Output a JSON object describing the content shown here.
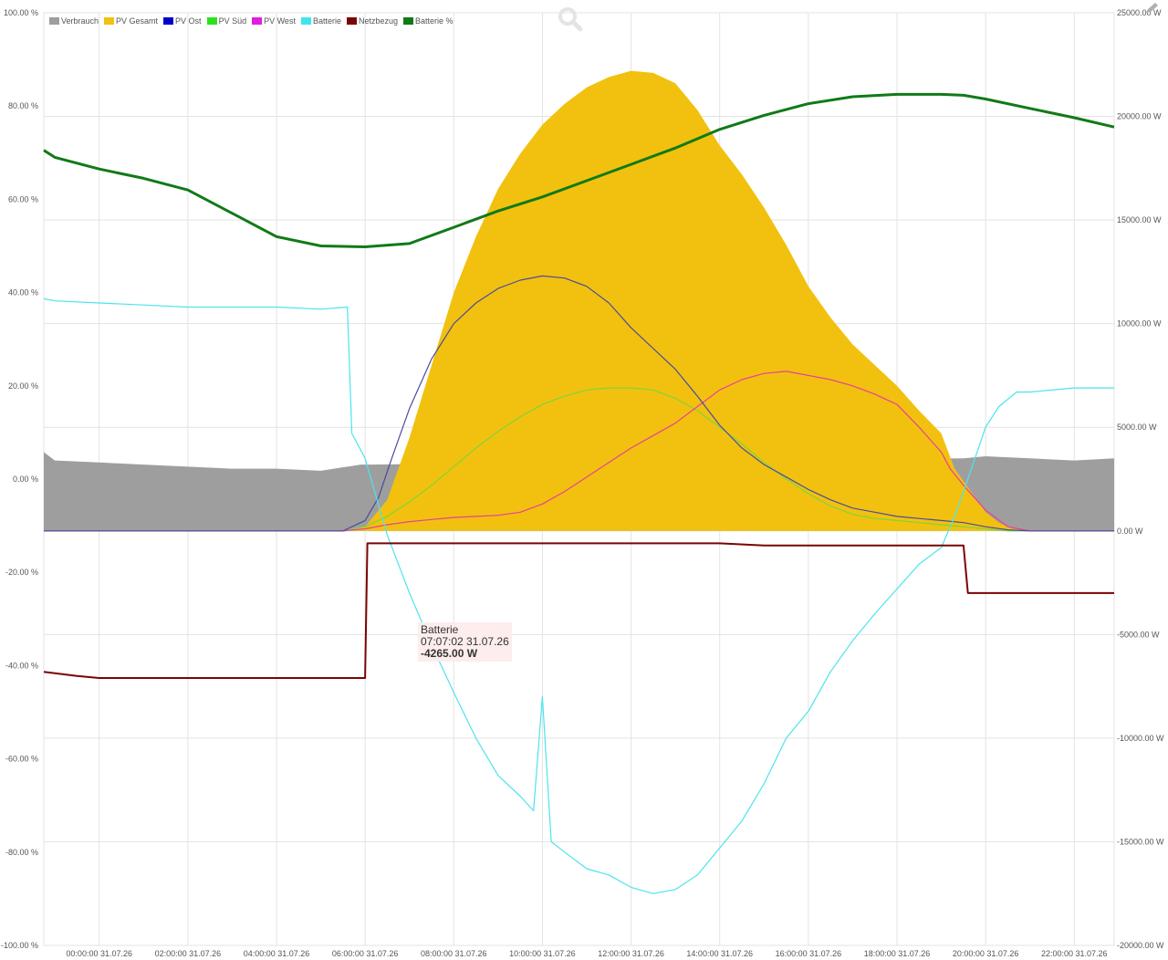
{
  "chart_data": {
    "type": "area",
    "y_left": {
      "min": -100,
      "max": 100,
      "ticks": [
        "100.00 %",
        "80.00 %",
        "60.00 %",
        "40.00 %",
        "20.00 %",
        "0.00 %",
        "-20.00 %",
        "-40.00 %",
        "-60.00 %",
        "-80.00 %",
        "-100.00 %"
      ]
    },
    "y_right": {
      "min": -20000,
      "max": 25000,
      "ticks": [
        "25000.00 W",
        "20000.00 W",
        "15000.00 W",
        "10000.00 W",
        "5000.00 W",
        "0.00 W",
        "-5000.00 W",
        "-10000.00 W",
        "-15000.00 W",
        "-20000.00 W"
      ]
    },
    "x_range_hours": [
      23.0,
      22.9
    ],
    "x_ticks": [
      {
        "h": 0,
        "label": "00:00:00 31.07.26"
      },
      {
        "h": 2,
        "label": "02:00:00 31.07.26"
      },
      {
        "h": 4,
        "label": "04:00:00 31.07.26"
      },
      {
        "h": 6,
        "label": "06:00:00 31.07.26"
      },
      {
        "h": 8,
        "label": "08:00:00 31.07.26"
      },
      {
        "h": 10,
        "label": "10:00:00 31.07.26"
      },
      {
        "h": 12,
        "label": "12:00:00 31.07.26"
      },
      {
        "h": 14,
        "label": "14:00:00 31.07.26"
      },
      {
        "h": 16,
        "label": "16:00:00 31.07.26"
      },
      {
        "h": 18,
        "label": "18:00:00 31.07.26"
      },
      {
        "h": 20,
        "label": "20:00:00 31.07.26"
      },
      {
        "h": 22,
        "label": "22:00:00 31.07.26"
      }
    ],
    "grid": true,
    "legend_position": "top-left",
    "series": [
      {
        "name": "Verbrauch",
        "color": "#9e9e9e",
        "axis": "W",
        "style": "area",
        "points": [
          [
            -1.25,
            3800
          ],
          [
            -1,
            3400
          ],
          [
            0,
            3300
          ],
          [
            1,
            3200
          ],
          [
            2,
            3100
          ],
          [
            3,
            3000
          ],
          [
            4,
            3000
          ],
          [
            5,
            2900
          ],
          [
            5.9,
            3200
          ],
          [
            6.1,
            3200
          ],
          [
            19.5,
            3500
          ],
          [
            20,
            3600
          ],
          [
            21,
            3500
          ],
          [
            22,
            3400
          ],
          [
            22.9,
            3500
          ]
        ]
      },
      {
        "name": "PV Gesamt",
        "color": "#f2c10f",
        "axis": "W",
        "style": "area",
        "points": [
          [
            -1.25,
            0
          ],
          [
            5.5,
            0
          ],
          [
            6,
            200
          ],
          [
            6.5,
            1500
          ],
          [
            7,
            4500
          ],
          [
            7.5,
            8000
          ],
          [
            8,
            11500
          ],
          [
            8.5,
            14200
          ],
          [
            9,
            16500
          ],
          [
            9.5,
            18200
          ],
          [
            10,
            19600
          ],
          [
            10.5,
            20600
          ],
          [
            11,
            21400
          ],
          [
            11.5,
            21900
          ],
          [
            12,
            22200
          ],
          [
            12.5,
            22100
          ],
          [
            13,
            21600
          ],
          [
            13.5,
            20300
          ],
          [
            14,
            18600
          ],
          [
            14.5,
            17200
          ],
          [
            15,
            15600
          ],
          [
            15.5,
            13800
          ],
          [
            16,
            11800
          ],
          [
            16.5,
            10300
          ],
          [
            17,
            9000
          ],
          [
            17.5,
            8000
          ],
          [
            18,
            7000
          ],
          [
            18.5,
            5800
          ],
          [
            19,
            4700
          ],
          [
            19.3,
            3000
          ],
          [
            19.7,
            1800
          ],
          [
            20,
            900
          ],
          [
            20.3,
            400
          ],
          [
            20.6,
            100
          ],
          [
            21,
            0
          ],
          [
            22.9,
            0
          ]
        ]
      },
      {
        "name": "PV Ost",
        "color": "#4b4b9e",
        "axis": "W",
        "style": "line",
        "points": [
          [
            -1.25,
            0
          ],
          [
            5.5,
            0
          ],
          [
            6,
            500
          ],
          [
            6.3,
            1600
          ],
          [
            6.6,
            3500
          ],
          [
            7,
            5900
          ],
          [
            7.5,
            8300
          ],
          [
            8,
            10000
          ],
          [
            8.5,
            11000
          ],
          [
            9,
            11700
          ],
          [
            9.5,
            12100
          ],
          [
            10,
            12300
          ],
          [
            10.5,
            12200
          ],
          [
            11,
            11800
          ],
          [
            11.5,
            11000
          ],
          [
            12,
            9800
          ],
          [
            12.5,
            8800
          ],
          [
            13,
            7800
          ],
          [
            13.5,
            6500
          ],
          [
            14,
            5100
          ],
          [
            14.5,
            4000
          ],
          [
            15,
            3200
          ],
          [
            15.5,
            2600
          ],
          [
            16,
            2000
          ],
          [
            16.5,
            1500
          ],
          [
            17,
            1100
          ],
          [
            17.5,
            900
          ],
          [
            18,
            700
          ],
          [
            18.5,
            600
          ],
          [
            19,
            500
          ],
          [
            19.5,
            400
          ],
          [
            20,
            200
          ],
          [
            20.5,
            50
          ],
          [
            21,
            0
          ],
          [
            22.9,
            0
          ]
        ]
      },
      {
        "name": "PV Süd",
        "color": "#7cd63a",
        "axis": "W",
        "style": "line",
        "points": [
          [
            -1.25,
            0
          ],
          [
            5.5,
            0
          ],
          [
            6,
            200
          ],
          [
            6.5,
            700
          ],
          [
            7,
            1400
          ],
          [
            7.5,
            2200
          ],
          [
            8,
            3100
          ],
          [
            8.5,
            4000
          ],
          [
            9,
            4800
          ],
          [
            9.5,
            5500
          ],
          [
            10,
            6100
          ],
          [
            10.5,
            6500
          ],
          [
            11,
            6800
          ],
          [
            11.5,
            6900
          ],
          [
            12,
            6900
          ],
          [
            12.5,
            6800
          ],
          [
            13,
            6400
          ],
          [
            13.5,
            5800
          ],
          [
            14,
            5000
          ],
          [
            14.5,
            4200
          ],
          [
            15,
            3300
          ],
          [
            15.5,
            2500
          ],
          [
            16,
            1800
          ],
          [
            16.5,
            1200
          ],
          [
            17,
            800
          ],
          [
            17.5,
            600
          ],
          [
            18,
            500
          ],
          [
            18.5,
            400
          ],
          [
            19,
            300
          ],
          [
            19.5,
            200
          ],
          [
            20,
            100
          ],
          [
            20.5,
            0
          ],
          [
            22.9,
            0
          ]
        ]
      },
      {
        "name": "PV West",
        "color": "#e8409a",
        "axis": "W",
        "style": "line",
        "points": [
          [
            -1.25,
            0
          ],
          [
            5.5,
            0
          ],
          [
            6,
            100
          ],
          [
            6.5,
            300
          ],
          [
            7,
            450
          ],
          [
            7.5,
            550
          ],
          [
            8,
            650
          ],
          [
            8.5,
            700
          ],
          [
            9,
            750
          ],
          [
            9.5,
            900
          ],
          [
            10,
            1300
          ],
          [
            10.5,
            1900
          ],
          [
            11,
            2600
          ],
          [
            11.5,
            3300
          ],
          [
            12,
            4000
          ],
          [
            12.5,
            4600
          ],
          [
            13,
            5200
          ],
          [
            13.5,
            6000
          ],
          [
            14,
            6800
          ],
          [
            14.5,
            7300
          ],
          [
            15,
            7600
          ],
          [
            15.5,
            7700
          ],
          [
            16,
            7500
          ],
          [
            16.5,
            7300
          ],
          [
            17,
            7000
          ],
          [
            17.5,
            6600
          ],
          [
            18,
            6100
          ],
          [
            18.5,
            5000
          ],
          [
            19,
            3800
          ],
          [
            19.2,
            3000
          ],
          [
            19.5,
            2200
          ],
          [
            20,
            1000
          ],
          [
            20.5,
            200
          ],
          [
            21,
            0
          ],
          [
            22.9,
            0
          ]
        ]
      },
      {
        "name": "Batterie",
        "color": "#4ce4ec",
        "axis": "W",
        "style": "line",
        "points": [
          [
            -1.25,
            11200
          ],
          [
            -1,
            11100
          ],
          [
            0,
            11000
          ],
          [
            1,
            10900
          ],
          [
            2,
            10800
          ],
          [
            3,
            10800
          ],
          [
            4,
            10800
          ],
          [
            5,
            10700
          ],
          [
            5.6,
            10800
          ],
          [
            5.7,
            4700
          ],
          [
            6,
            3500
          ],
          [
            6.5,
            -200
          ],
          [
            7,
            -3000
          ],
          [
            7.5,
            -5500
          ],
          [
            8,
            -7800
          ],
          [
            8.5,
            -10000
          ],
          [
            9,
            -11800
          ],
          [
            9.5,
            -12800
          ],
          [
            9.8,
            -13500
          ],
          [
            10,
            -8000
          ],
          [
            10.2,
            -15000
          ],
          [
            10.5,
            -15500
          ],
          [
            11,
            -16300
          ],
          [
            11.5,
            -16600
          ],
          [
            12,
            -17200
          ],
          [
            12.5,
            -17500
          ],
          [
            13,
            -17300
          ],
          [
            13.5,
            -16600
          ],
          [
            14,
            -15300
          ],
          [
            14.5,
            -14000
          ],
          [
            15,
            -12200
          ],
          [
            15.5,
            -10000
          ],
          [
            16,
            -8700
          ],
          [
            16.5,
            -6800
          ],
          [
            17,
            -5300
          ],
          [
            17.5,
            -4000
          ],
          [
            18,
            -2800
          ],
          [
            18.5,
            -1600
          ],
          [
            19,
            -800
          ],
          [
            19.3,
            700
          ],
          [
            19.6,
            2500
          ],
          [
            20,
            5000
          ],
          [
            20.3,
            6000
          ],
          [
            20.7,
            6700
          ],
          [
            21,
            6700
          ],
          [
            22,
            6900
          ],
          [
            22.9,
            6900
          ]
        ]
      },
      {
        "name": "Netzbezug",
        "color": "#7a0404",
        "axis": "W",
        "style": "line",
        "points": [
          [
            -1.25,
            -6800
          ],
          [
            -0.5,
            -7000
          ],
          [
            0,
            -7100
          ],
          [
            1,
            -7100
          ],
          [
            2,
            -7100
          ],
          [
            3,
            -7100
          ],
          [
            4,
            -7100
          ],
          [
            5,
            -7100
          ],
          [
            6,
            -7100
          ],
          [
            6.05,
            -600
          ],
          [
            7,
            -600
          ],
          [
            8,
            -600
          ],
          [
            9,
            -600
          ],
          [
            10,
            -600
          ],
          [
            11,
            -600
          ],
          [
            12,
            -600
          ],
          [
            13,
            -600
          ],
          [
            14,
            -600
          ],
          [
            15,
            -700
          ],
          [
            16,
            -700
          ],
          [
            17,
            -700
          ],
          [
            18,
            -700
          ],
          [
            19,
            -700
          ],
          [
            19.5,
            -700
          ],
          [
            19.6,
            -3000
          ],
          [
            20,
            -3000
          ],
          [
            21,
            -3000
          ],
          [
            22,
            -3000
          ],
          [
            22.9,
            -3000
          ]
        ]
      },
      {
        "name": "Batterie %",
        "color": "#117a17",
        "axis": "%",
        "style": "line",
        "points": [
          [
            -1.25,
            70.5
          ],
          [
            -1,
            69
          ],
          [
            0,
            66.5
          ],
          [
            1,
            64.5
          ],
          [
            2,
            62
          ],
          [
            3,
            57
          ],
          [
            4,
            52
          ],
          [
            5,
            50
          ],
          [
            6,
            49.8
          ],
          [
            7,
            50.5
          ],
          [
            8,
            54
          ],
          [
            9,
            57.5
          ],
          [
            10,
            60.5
          ],
          [
            11,
            64
          ],
          [
            12,
            67.5
          ],
          [
            13,
            71
          ],
          [
            14,
            75
          ],
          [
            15,
            78
          ],
          [
            16,
            80.5
          ],
          [
            17,
            82
          ],
          [
            18,
            82.5
          ],
          [
            19,
            82.5
          ],
          [
            19.5,
            82.3
          ],
          [
            20,
            81.5
          ],
          [
            21,
            79.5
          ],
          [
            22,
            77.5
          ],
          [
            22.9,
            75.5
          ]
        ]
      }
    ]
  },
  "legend": [
    {
      "label": "Verbrauch",
      "color": "#9e9e9e"
    },
    {
      "label": "PV Gesamt",
      "color": "#f2c10f"
    },
    {
      "label": "PV Ost",
      "color": "#0000c8"
    },
    {
      "label": "PV Süd",
      "color": "#2be21b"
    },
    {
      "label": "PV West",
      "color": "#e21be0"
    },
    {
      "label": "Batterie",
      "color": "#3de6ec"
    },
    {
      "label": "Netzbezug",
      "color": "#7a0404"
    },
    {
      "label": "Batterie %",
      "color": "#117a17"
    }
  ],
  "tooltip": {
    "series": "Batterie",
    "time": "07:07:02 31.07.26",
    "value": "-4265.00 W"
  },
  "icons": {
    "zoom": "magnifier-icon",
    "edit": "pencil-icon"
  }
}
